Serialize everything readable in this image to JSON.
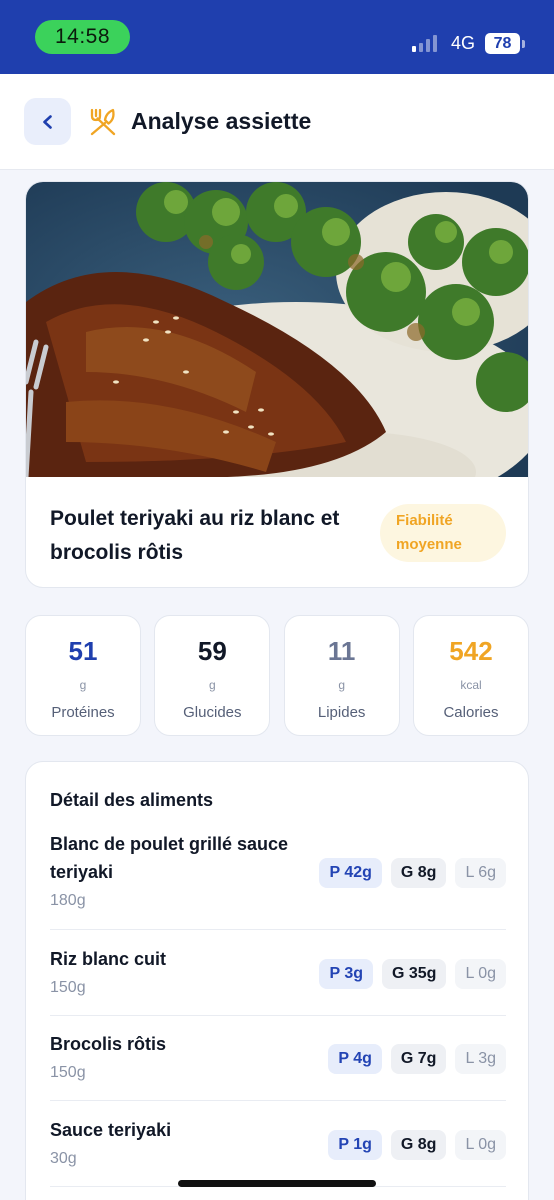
{
  "status_bar": {
    "time": "14:58",
    "network": "4G",
    "battery": "78"
  },
  "header": {
    "back_icon": "chevron-left-icon",
    "app_icon": "fork-knife-icon",
    "title": "Analyse assiette"
  },
  "meal": {
    "name": "Poulet teriyaki au riz blanc et brocolis rôtis",
    "reliability": "Fiabilité moyenne",
    "photo_icon": "meal-photo"
  },
  "stats": [
    {
      "value": "51",
      "unit": "g",
      "label": "Protéines",
      "color": "#1f3fae"
    },
    {
      "value": "59",
      "unit": "g",
      "label": "Glucides",
      "color": "#111827"
    },
    {
      "value": "11",
      "unit": "g",
      "label": "Lipides",
      "color": "#6b7694"
    },
    {
      "value": "542",
      "unit": "kcal",
      "label": "Calories",
      "color": "#f0a524"
    }
  ],
  "detail": {
    "title": "Détail des aliments",
    "items": [
      {
        "name": "Blanc de poulet grillé sauce teriyaki",
        "weight": "180g",
        "p": "P 42g",
        "g": "G 8g",
        "l": "L 6g"
      },
      {
        "name": "Riz blanc cuit",
        "weight": "150g",
        "p": "P 3g",
        "g": "G 35g",
        "l": "L 0g"
      },
      {
        "name": "Brocolis rôtis",
        "weight": "150g",
        "p": "P 4g",
        "g": "G 7g",
        "l": "L 3g"
      },
      {
        "name": "Sauce teriyaki",
        "weight": "30g",
        "p": "P 1g",
        "g": "G 8g",
        "l": "L 0g"
      }
    ]
  },
  "colors": {
    "brand": "#1f3fae",
    "accent": "#f0a524",
    "status_pill": "#3bd25b"
  }
}
